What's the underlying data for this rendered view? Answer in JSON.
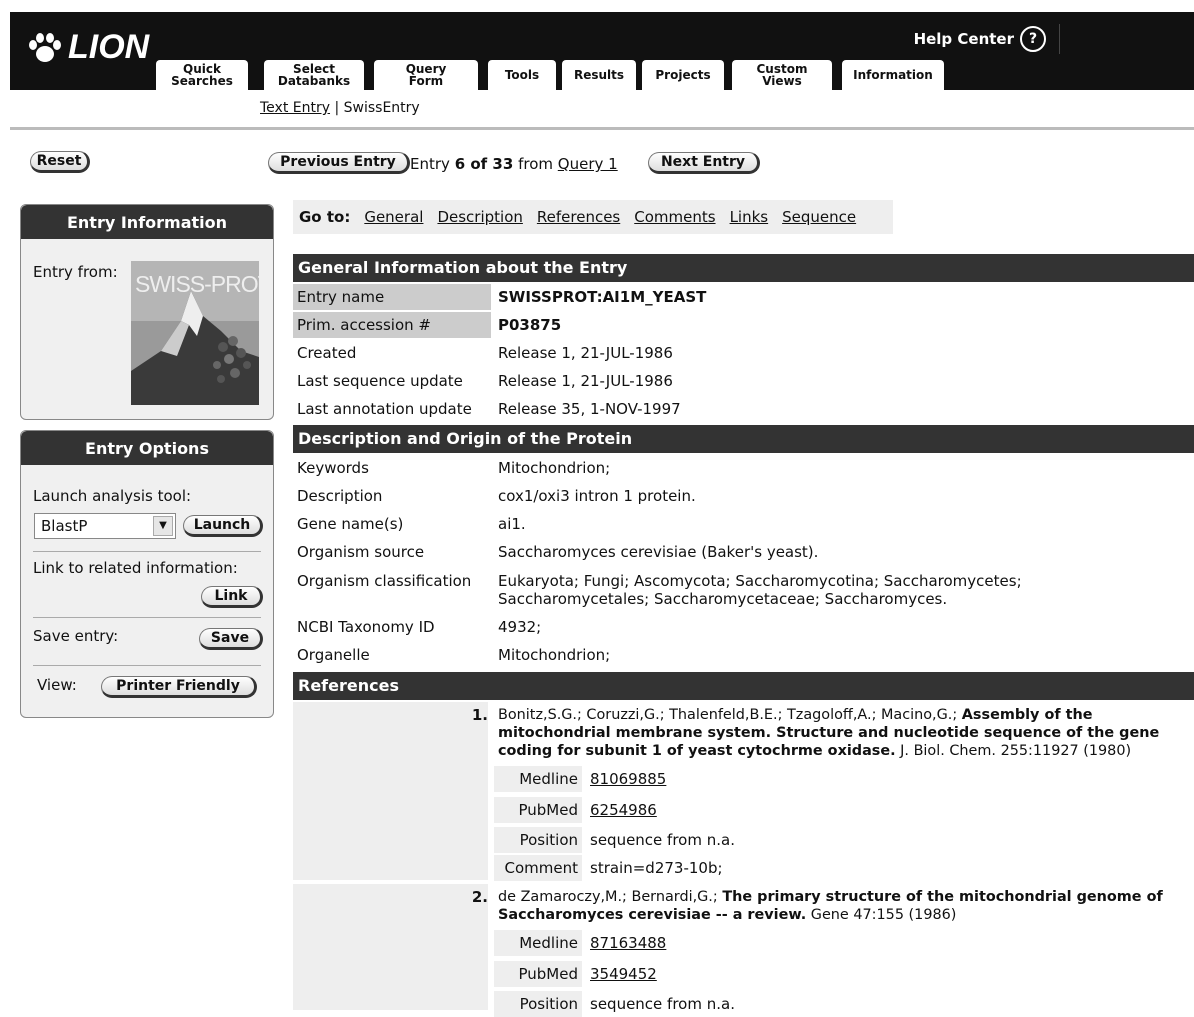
{
  "header": {
    "logo_text": "LION",
    "help_label": "Help Center",
    "help_icon": "?",
    "tabs": [
      {
        "l1": "Quick",
        "l2": "Searches"
      },
      {
        "l1": "Select",
        "l2": "Databanks"
      },
      {
        "l1": "Query",
        "l2": "Form"
      },
      {
        "l1": "Tools",
        "l2": ""
      },
      {
        "l1": "Results",
        "l2": ""
      },
      {
        "l1": "Projects",
        "l2": ""
      },
      {
        "l1": "Custom",
        "l2": "Views"
      },
      {
        "l1": "Information",
        "l2": ""
      }
    ]
  },
  "subnav": {
    "text_entry": "Text Entry",
    "separator": "|",
    "swiss_entry": "SwissEntry"
  },
  "nav": {
    "reset": "Reset",
    "prev": "Previous Entry",
    "entry_word": "Entry",
    "pos": "6 of 33",
    "from_word": "from",
    "query": "Query 1",
    "next": "Next Entry"
  },
  "entry_info": {
    "title": "Entry Information",
    "label": "Entry from:",
    "image_text": "SWISS-PROT"
  },
  "entry_options": {
    "title": "Entry Options",
    "launch_label": "Launch analysis tool:",
    "tool_selected": "BlastP",
    "launch_btn": "Launch",
    "link_label": "Link to related information:",
    "link_btn": "Link",
    "save_label": "Save entry:",
    "save_btn": "Save",
    "view_label": "View:",
    "printer_btn": "Printer Friendly"
  },
  "goto": {
    "label": "Go to:",
    "links": [
      "General",
      "Description",
      "References",
      "Comments",
      "Links",
      "Sequence"
    ]
  },
  "general": {
    "title": "General Information about the Entry",
    "rows": [
      {
        "k": "Entry name",
        "v": "SWISSPROT:AI1M_YEAST"
      },
      {
        "k": "Prim. accession #",
        "v": "P03875"
      },
      {
        "k": "Created",
        "v": "Release 1, 21-JUL-1986"
      },
      {
        "k": "Last sequence update",
        "v": "Release 1, 21-JUL-1986"
      },
      {
        "k": "Last annotation update",
        "v": "Release 35, 1-NOV-1997"
      }
    ]
  },
  "description": {
    "title": "Description and Origin of the Protein",
    "rows": [
      {
        "k": "Keywords",
        "v": "Mitochondrion;"
      },
      {
        "k": "Description",
        "v": "cox1/oxi3 intron 1 protein."
      },
      {
        "k": "Gene name(s)",
        "v": "ai1."
      },
      {
        "k": "Organism source",
        "v": "Saccharomyces cerevisiae (Baker's yeast)."
      },
      {
        "k": "Organism classification",
        "v": "Eukaryota; Fungi; Ascomycota; Saccharomycotina; Saccharomycetes;",
        "v2": "Saccharomycetales; Saccharomycetaceae; Saccharomyces."
      },
      {
        "k": "NCBI Taxonomy ID",
        "v": "4932;"
      },
      {
        "k": "Organelle",
        "v": "Mitochondrion;"
      }
    ]
  },
  "references": {
    "title": "References",
    "items": [
      {
        "num": "1.",
        "authors": "Bonitz,S.G.; Coruzzi,G.; Thalenfeld,B.E.; Tzagoloff,A.; Macino,G.;",
        "title_l1": "Assembly of the",
        "title_l2": "mitochondrial membrane system. Structure and nucleotide sequence of the gene",
        "title_l3": "coding for subunit 1 of yeast cytochrme oxidase.",
        "journal": "J. Biol. Chem. 255:11927 (1980)",
        "medline_k": "Medline",
        "medline_v": "81069885",
        "pubmed_k": "PubMed",
        "pubmed_v": "6254986",
        "position_k": "Position",
        "position_v": "sequence from n.a.",
        "comment_k": "Comment",
        "comment_v": "strain=d273-10b;"
      },
      {
        "num": "2.",
        "authors": "de Zamaroczy,M.; Bernardi,G.;",
        "title_l1": "The primary structure of the mitochondrial genome of",
        "title_l2": "Saccharomyces cerevisiae -- a review.",
        "journal": "Gene 47:155 (1986)",
        "medline_k": "Medline",
        "medline_v": "87163488",
        "pubmed_k": "PubMed",
        "pubmed_v": "3549452",
        "position_k": "Position",
        "position_v": "sequence from n.a."
      }
    ]
  }
}
